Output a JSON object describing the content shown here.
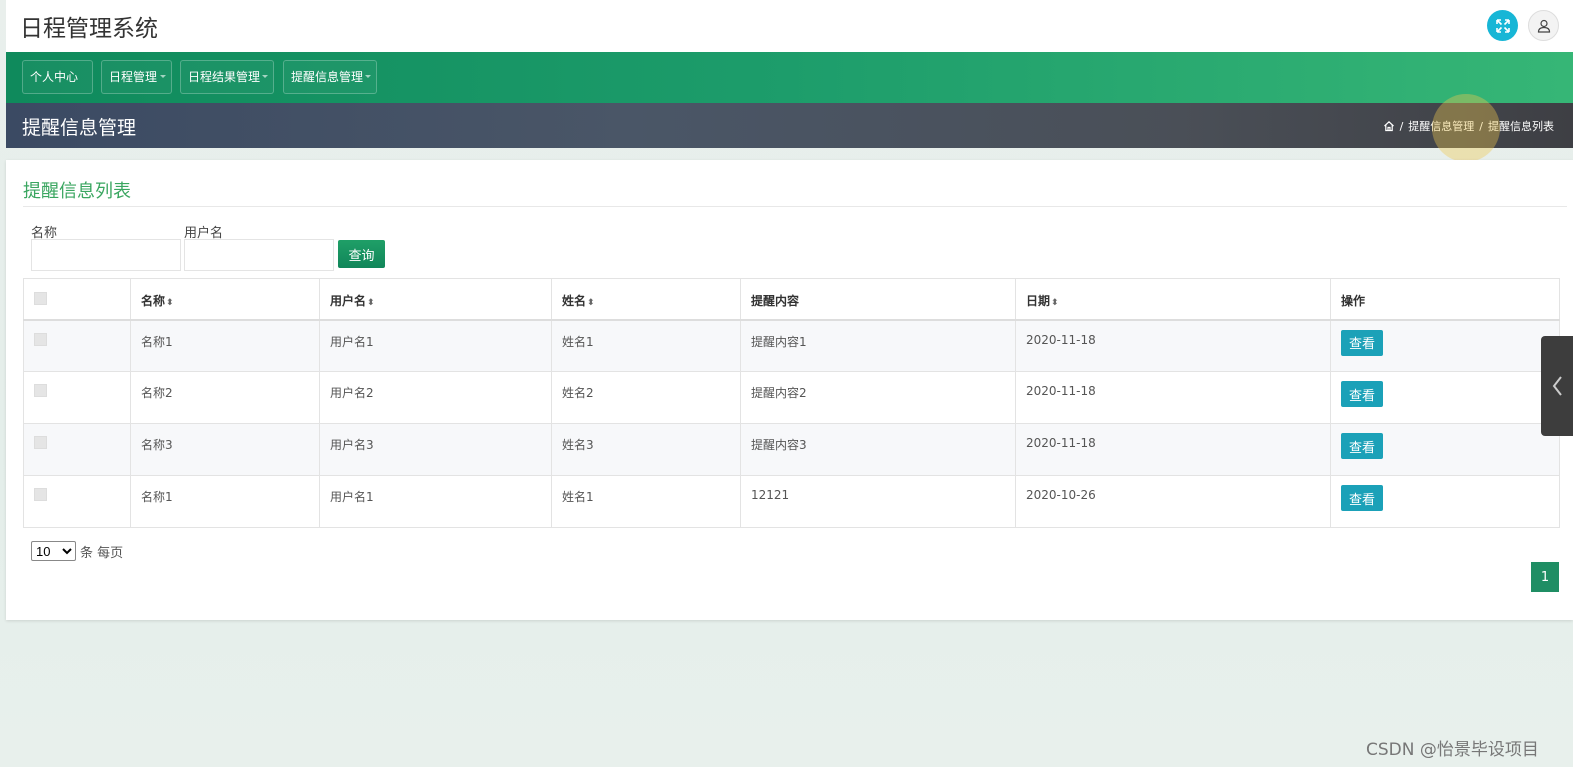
{
  "app": {
    "title": "日程管理系统"
  },
  "nav": {
    "items": [
      {
        "label": "个人中心"
      },
      {
        "label": "日程管理"
      },
      {
        "label": "日程结果管理"
      },
      {
        "label": "提醒信息管理"
      }
    ]
  },
  "page": {
    "title": "提醒信息管理",
    "breadcrumb": [
      "提醒信息管理",
      "提醒信息列表"
    ]
  },
  "panel": {
    "title": "提醒信息列表"
  },
  "filters": {
    "name_label": "名称",
    "name_value": "",
    "username_label": "用户名",
    "username_value": "",
    "search_label": "查询"
  },
  "table": {
    "columns": [
      "名称",
      "用户名",
      "姓名",
      "提醒内容",
      "日期",
      "操作"
    ],
    "view_label": "查看",
    "rows": [
      {
        "name": "名称1",
        "username": "用户名1",
        "realname": "姓名1",
        "content": "提醒内容1",
        "date": "2020-11-18"
      },
      {
        "name": "名称2",
        "username": "用户名2",
        "realname": "姓名2",
        "content": "提醒内容2",
        "date": "2020-11-18"
      },
      {
        "name": "名称3",
        "username": "用户名3",
        "realname": "姓名3",
        "content": "提醒内容3",
        "date": "2020-11-18"
      },
      {
        "name": "名称1",
        "username": "用户名1",
        "realname": "姓名1",
        "content": "12121",
        "date": "2020-10-26"
      }
    ]
  },
  "pagination": {
    "page_size": "10",
    "page_size_options": [
      "10"
    ],
    "per_page_suffix": "条 每页",
    "current_page": "1"
  },
  "watermark": "CSDN @怡景毕设项目",
  "colors": {
    "nav_green": "#1d9d6b",
    "title_green": "#3aa660",
    "view_button": "#1ba1b8",
    "expand_button": "#17b6d6"
  },
  "icons": {
    "expand": "expand-icon",
    "user": "user-icon",
    "home": "home-icon",
    "side": "chevron-left-icon"
  }
}
